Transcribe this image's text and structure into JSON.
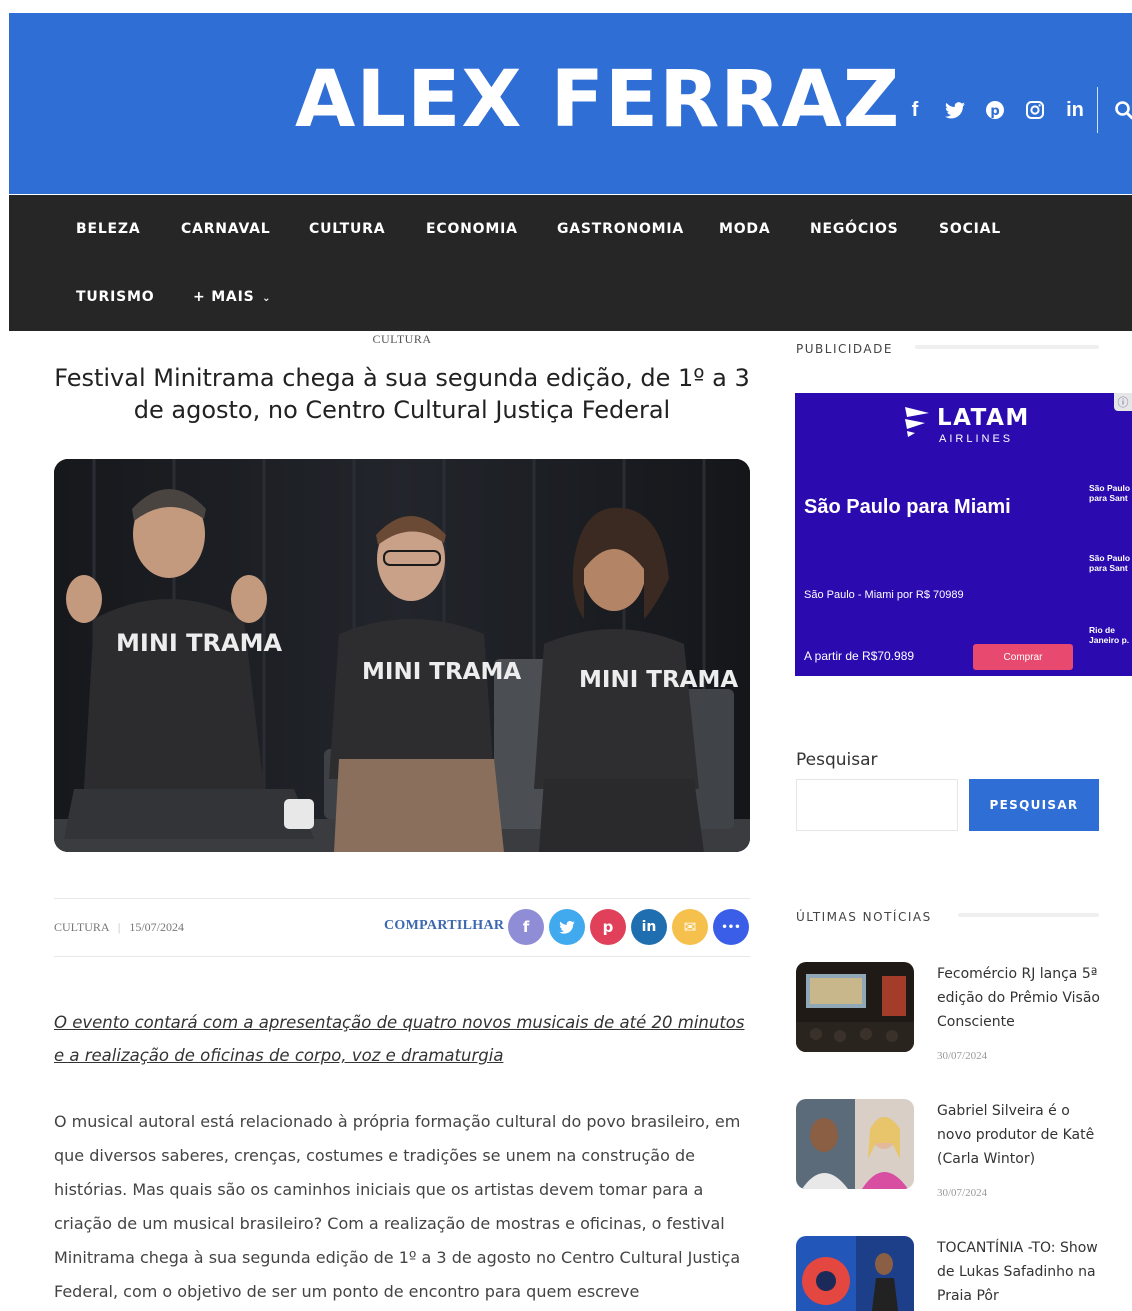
{
  "site": {
    "logo": "ALEX FERRAZ",
    "social_icons": [
      "facebook-icon",
      "twitter-icon",
      "pinterest-icon",
      "instagram-icon",
      "linkedin-icon"
    ],
    "search_icon": "search-icon",
    "brand_color": "#2f6ed4",
    "nav_bg": "#262626"
  },
  "nav": {
    "items": [
      "BELEZA",
      "CARNAVAL",
      "CULTURA",
      "ECONOMIA",
      "GASTRONOMIA",
      "MODA",
      "NEGÓCIOS",
      "SOCIAL",
      "TURISMO",
      "+ MAIS"
    ]
  },
  "article": {
    "category": "CULTURA",
    "title": "Festival Minitrama chega à sua segunda edição, de 1º a 3 de agosto, no Centro Cultural Justiça Federal",
    "image_text": [
      "MINI TRAMA",
      "MINI TRAMA",
      "MINI TRAMA"
    ],
    "meta_category": "CULTURA",
    "meta_sep": "|",
    "date": "15/07/2024",
    "share_label": "COMPARTILHAR",
    "share_buttons": [
      {
        "icon": "facebook-icon",
        "color": "#8e8dd6",
        "glyph": "f"
      },
      {
        "icon": "twitter-icon",
        "color": "#41a9ee",
        "glyph": "t"
      },
      {
        "icon": "pinterest-icon",
        "color": "#e0405a",
        "glyph": "p"
      },
      {
        "icon": "linkedin-icon",
        "color": "#1f6fb0",
        "glyph": "in"
      },
      {
        "icon": "email-icon",
        "color": "#f5c04b",
        "glyph": "✉"
      },
      {
        "icon": "more-icon",
        "color": "#3a5ee8",
        "glyph": "•••"
      }
    ],
    "lead": "O evento contará com a apresentação de quatro novos musicais de até 20 minutos e a realização de oficinas de corpo, voz e dramaturgia",
    "body": "O musical autoral está relacionado à própria formação cultural do povo brasileiro, em que diversos saberes, crenças, costumes e tradições se unem na construção de histórias. Mas quais são os caminhos iniciais que os artistas devem tomar para a criação de um musical brasileiro? Com a realização de mostras e oficinas, o festival Minitrama chega à sua segunda edição de 1º a 3 de agosto no Centro Cultural Justiça Federal, com o objetivo de ser um ponto de encontro para quem escreve"
  },
  "sidebar": {
    "ad_heading": "PUBLICIDADE",
    "ad": {
      "brand": "LATAM",
      "brand_sub": "AIRLINES",
      "destination": "São Paulo para Miami",
      "price_line": "São Paulo - Miami por R$ 70989",
      "from": "A partir de R$70.989",
      "buy": "Comprar",
      "side_1": "São Paulo para Sant",
      "side_2": "São Paulo para Sant",
      "side_3": "Rio de Janeiro p.",
      "info": "ⓘ"
    },
    "search_label": "Pesquisar",
    "search_placeholder": "",
    "search_button": "PESQUISAR",
    "news_heading": "ÚLTIMAS NOTÍCIAS",
    "news": [
      {
        "title": "Fecomércio RJ lança 5ª edição do Prêmio Visão Consciente",
        "date": "30/07/2024"
      },
      {
        "title": "Gabriel Silveira é o novo produtor de Katê (Carla Wintor)",
        "date": "30/07/2024"
      },
      {
        "title": "TOCANTÍNIA -TO: Show de Lukas Safadinho na Praia Pôr",
        "date": ""
      }
    ]
  }
}
